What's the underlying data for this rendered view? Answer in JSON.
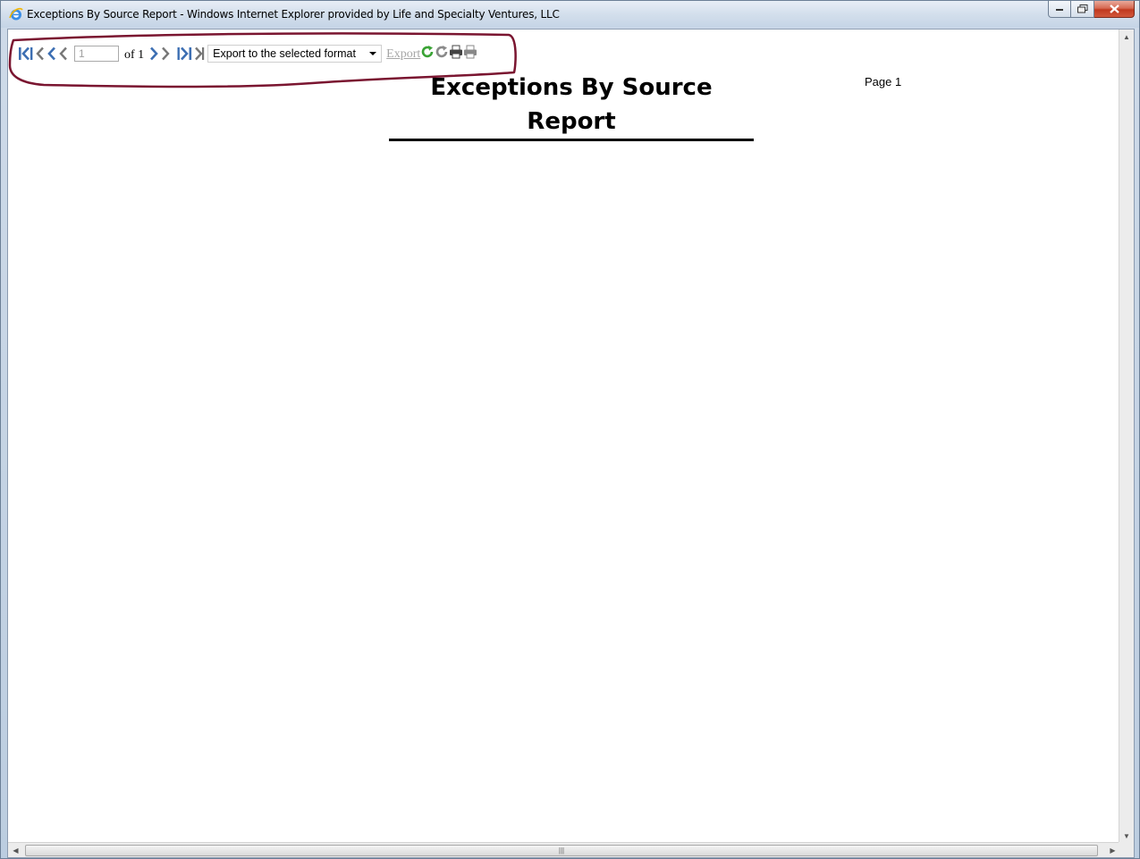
{
  "window": {
    "title": "Exceptions By Source Report - Windows Internet Explorer provided by Life and Specialty Ventures, LLC"
  },
  "toolbar": {
    "first_page_icon": "first-page-icon",
    "prev_page_icon": "previous-page-icon",
    "page_input_value": "1",
    "of_pages": "of 1",
    "next_page_icon": "next-page-icon",
    "last_page_icon": "last-page-icon",
    "export_format_selected": "Export to the selected format",
    "export_label": "Export",
    "refresh_icon": "refresh-icon",
    "print_icon": "print-icon"
  },
  "report": {
    "title": "Exceptions By Source Report",
    "page_label": "Page 1"
  },
  "colors": {
    "nav_arrow": "#3d6fb3",
    "annotation_outline": "#7a1530",
    "export_disabled": "#a6a6a6"
  }
}
